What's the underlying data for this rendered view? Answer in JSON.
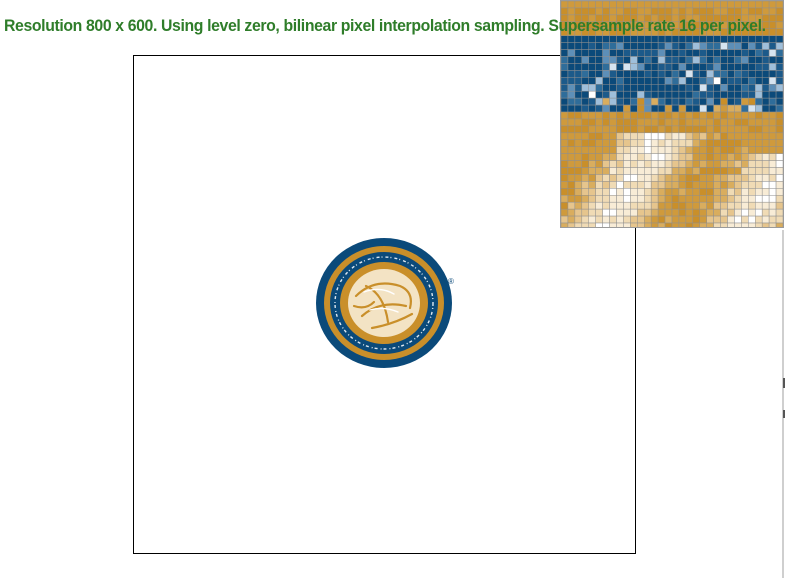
{
  "status": {
    "message": "Resolution 800 x 600. Using level zero, bilinear pixel interpolation sampling. Supersample rate 16 per pixel."
  },
  "colors": {
    "status_text": "#2f7d2a",
    "gold": "#c98f2a",
    "navy": "#0b4a7a",
    "cream": "#f3e3c4",
    "canvas_border": "#000000"
  },
  "canvas": {
    "seal_icon": "berkeley-seal-icon",
    "registered_mark": "®"
  },
  "zoom": {
    "icon": "pixel-inspector-grid"
  }
}
